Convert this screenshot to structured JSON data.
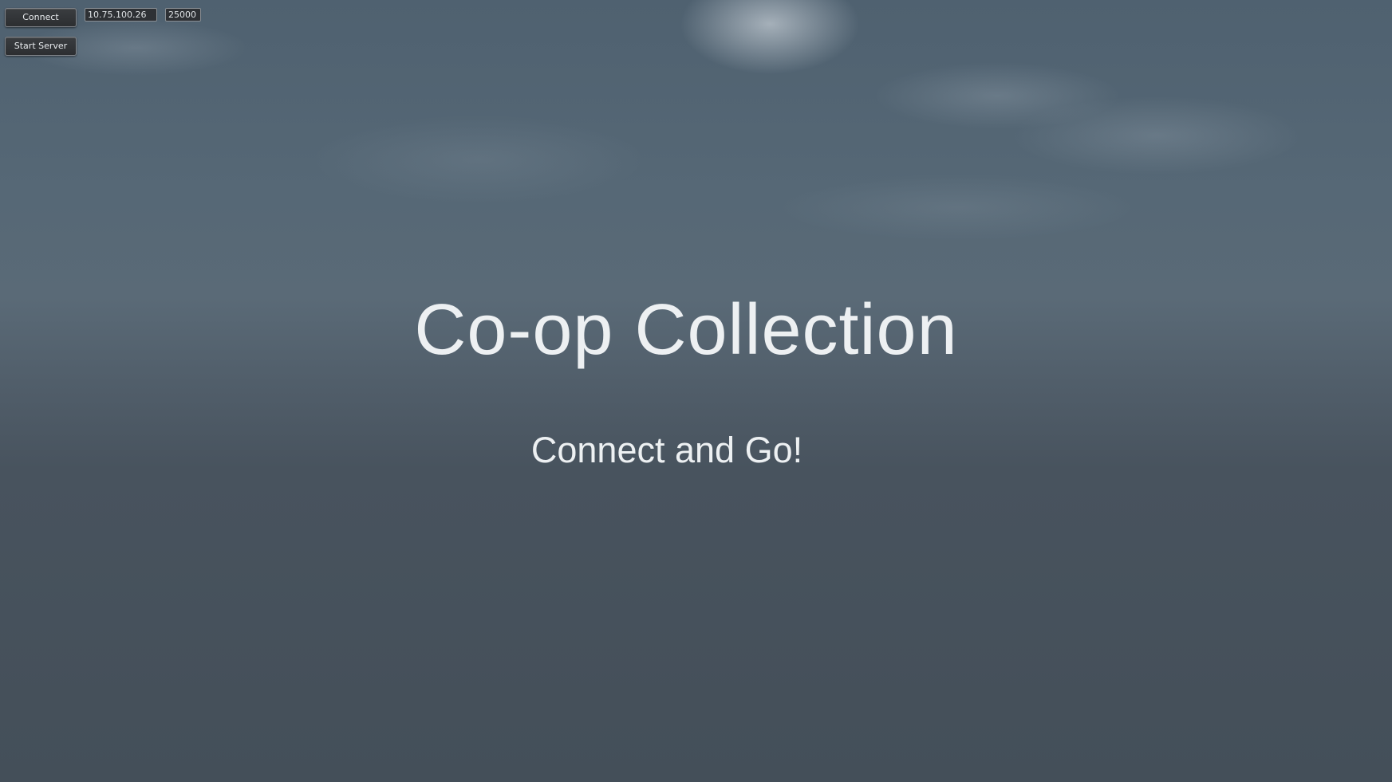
{
  "controls": {
    "connect_label": "Connect",
    "start_server_label": "Start Server",
    "ip_value": "10.75.100.26",
    "port_value": "25000"
  },
  "main": {
    "title": "Co-op Collection",
    "subtitle": "Connect and Go!"
  },
  "colors": {
    "sky_top": "#4f6170",
    "sky_bottom": "#444f59",
    "text": "#edf0f2",
    "button_bg": "#2c2e31"
  }
}
